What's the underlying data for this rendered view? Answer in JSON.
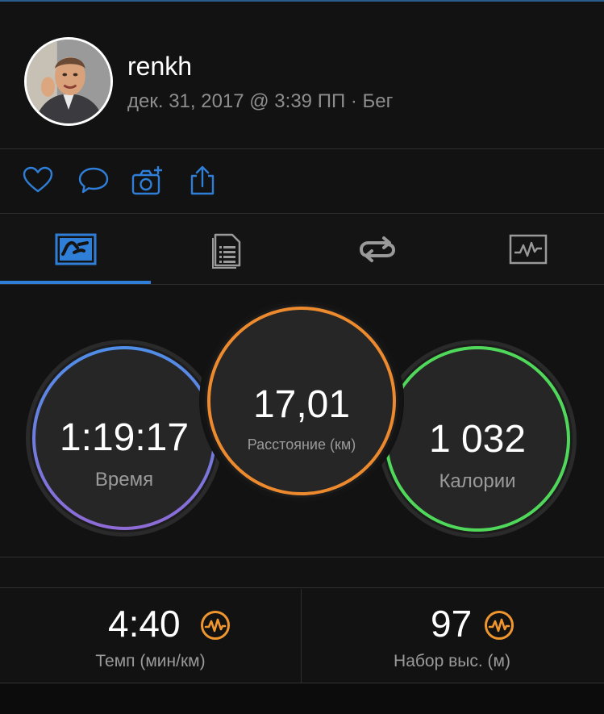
{
  "header": {
    "username": "renkh",
    "meta": "дек. 31, 2017 @ 3:39 ПП · Бег"
  },
  "actions": [
    {
      "icon": "heart-icon"
    },
    {
      "icon": "comment-icon"
    },
    {
      "icon": "add-photo-icon"
    },
    {
      "icon": "share-icon"
    }
  ],
  "tabs": [
    {
      "icon": "overview-tab-icon",
      "active": true
    },
    {
      "icon": "details-tab-icon",
      "active": false
    },
    {
      "icon": "laps-tab-icon",
      "active": false
    },
    {
      "icon": "charts-tab-icon",
      "active": false
    }
  ],
  "stats": {
    "time": {
      "value": "1:19:17",
      "label": "Время"
    },
    "distance": {
      "value": "17,01",
      "label": "Расстояние (км)"
    },
    "calories": {
      "value": "1 032",
      "label": "Калории"
    }
  },
  "bottom": {
    "pace": {
      "value": "4:40",
      "label": "Темп (мин/км)"
    },
    "elevation": {
      "value": "97",
      "label": "Набор выс. (м)"
    }
  },
  "colors": {
    "accent_blue": "#2f7ed8",
    "time_ring_start": "#4f8ee8",
    "time_ring_end": "#8e6bd6",
    "distance_ring": "#ee8a2e",
    "calories_ring": "#4fd85a",
    "hr_icon": "#f0962e"
  }
}
